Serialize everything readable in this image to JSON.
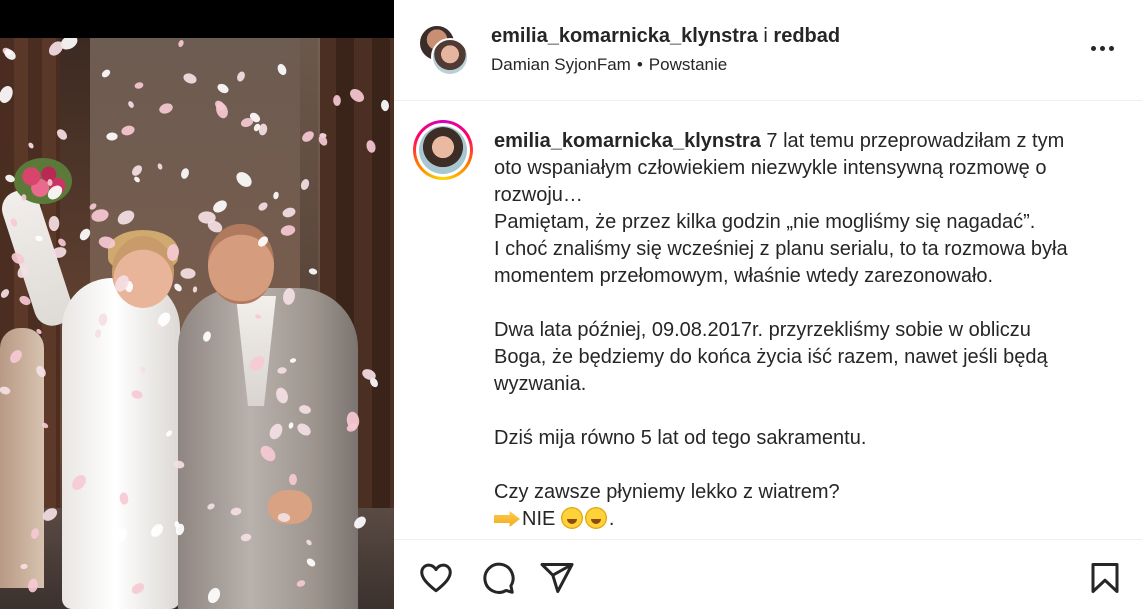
{
  "post": {
    "header": {
      "author": "emilia_komarnicka_klynstra",
      "connector": "i",
      "coauthor": "redbad",
      "audio": "Damian SyjonFam",
      "separator": "•",
      "audio_title": "Powstanie"
    },
    "caption": {
      "username": "emilia_komarnicka_klynstra",
      "lines": [
        " 7 lat temu przeprowadziłam z tym",
        "oto wspaniałym człowiekiem niezwykle intensywną rozmowę o",
        "rozwoju…",
        "Pamiętam, że przez kilka godzin „nie mogliśmy się nagadać”.",
        "I choć znaliśmy się wcześniej z planu serialu, to ta rozmowa była",
        "momentem przełomowym, właśnie wtedy zarezonowało.",
        "Dwa lata później, 09.08.2017r. przyrzekliśmy sobie w obliczu",
        "Boga, że będziemy do końca życia iść razem, nawet jeśli będą",
        "wyzwania.",
        "Dziś mija równo 5 lat od tego sakramentu.",
        "Czy zawsze płyniemy lekko z wiatrem?",
        "NIE",
        "."
      ]
    },
    "icons": {
      "more": "more-icon",
      "like": "heart-icon",
      "comment": "comment-icon",
      "share": "share-icon",
      "save": "bookmark-icon",
      "pointing_hand": "pointing-hand-emoji",
      "crazy_face": "zany-face-emoji"
    },
    "colors": {
      "text": "#262626",
      "divider": "#efefef",
      "story_ring": "#ff0069"
    }
  }
}
